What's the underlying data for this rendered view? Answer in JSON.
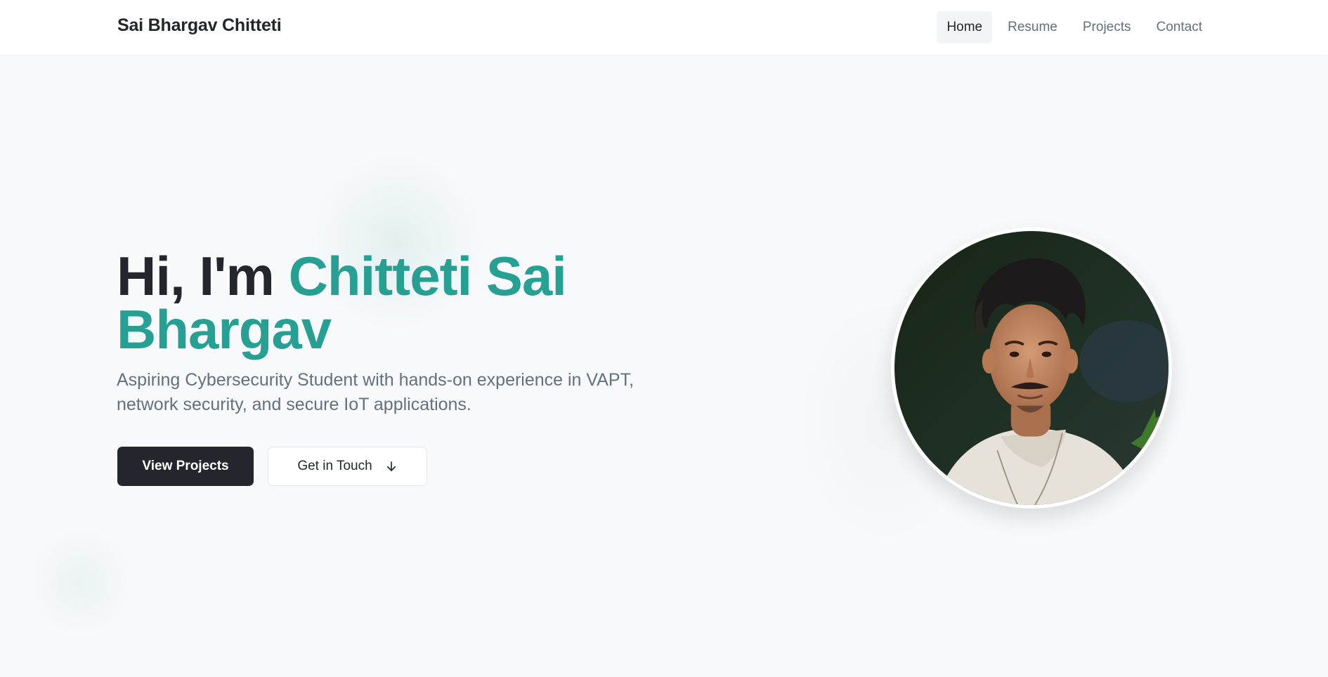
{
  "header": {
    "brand": "Sai Bhargav Chitteti",
    "nav": [
      {
        "label": "Home",
        "active": true
      },
      {
        "label": "Resume",
        "active": false
      },
      {
        "label": "Projects",
        "active": false
      },
      {
        "label": "Contact",
        "active": false
      }
    ]
  },
  "hero": {
    "greeting": "Hi, I'm ",
    "name": "Chitteti Sai Bhargav",
    "subtitle": "Aspiring Cybersecurity Student with hands-on experience in VAPT, network security, and secure IoT applications.",
    "primary_button": "View Projects",
    "secondary_button": "Get in Touch",
    "secondary_icon": "arrow-down-icon",
    "avatar": "profile-photo"
  },
  "colors": {
    "accent": "#27a094",
    "dark": "#23272d",
    "muted": "#64707d",
    "background": "#f8f9fb"
  }
}
